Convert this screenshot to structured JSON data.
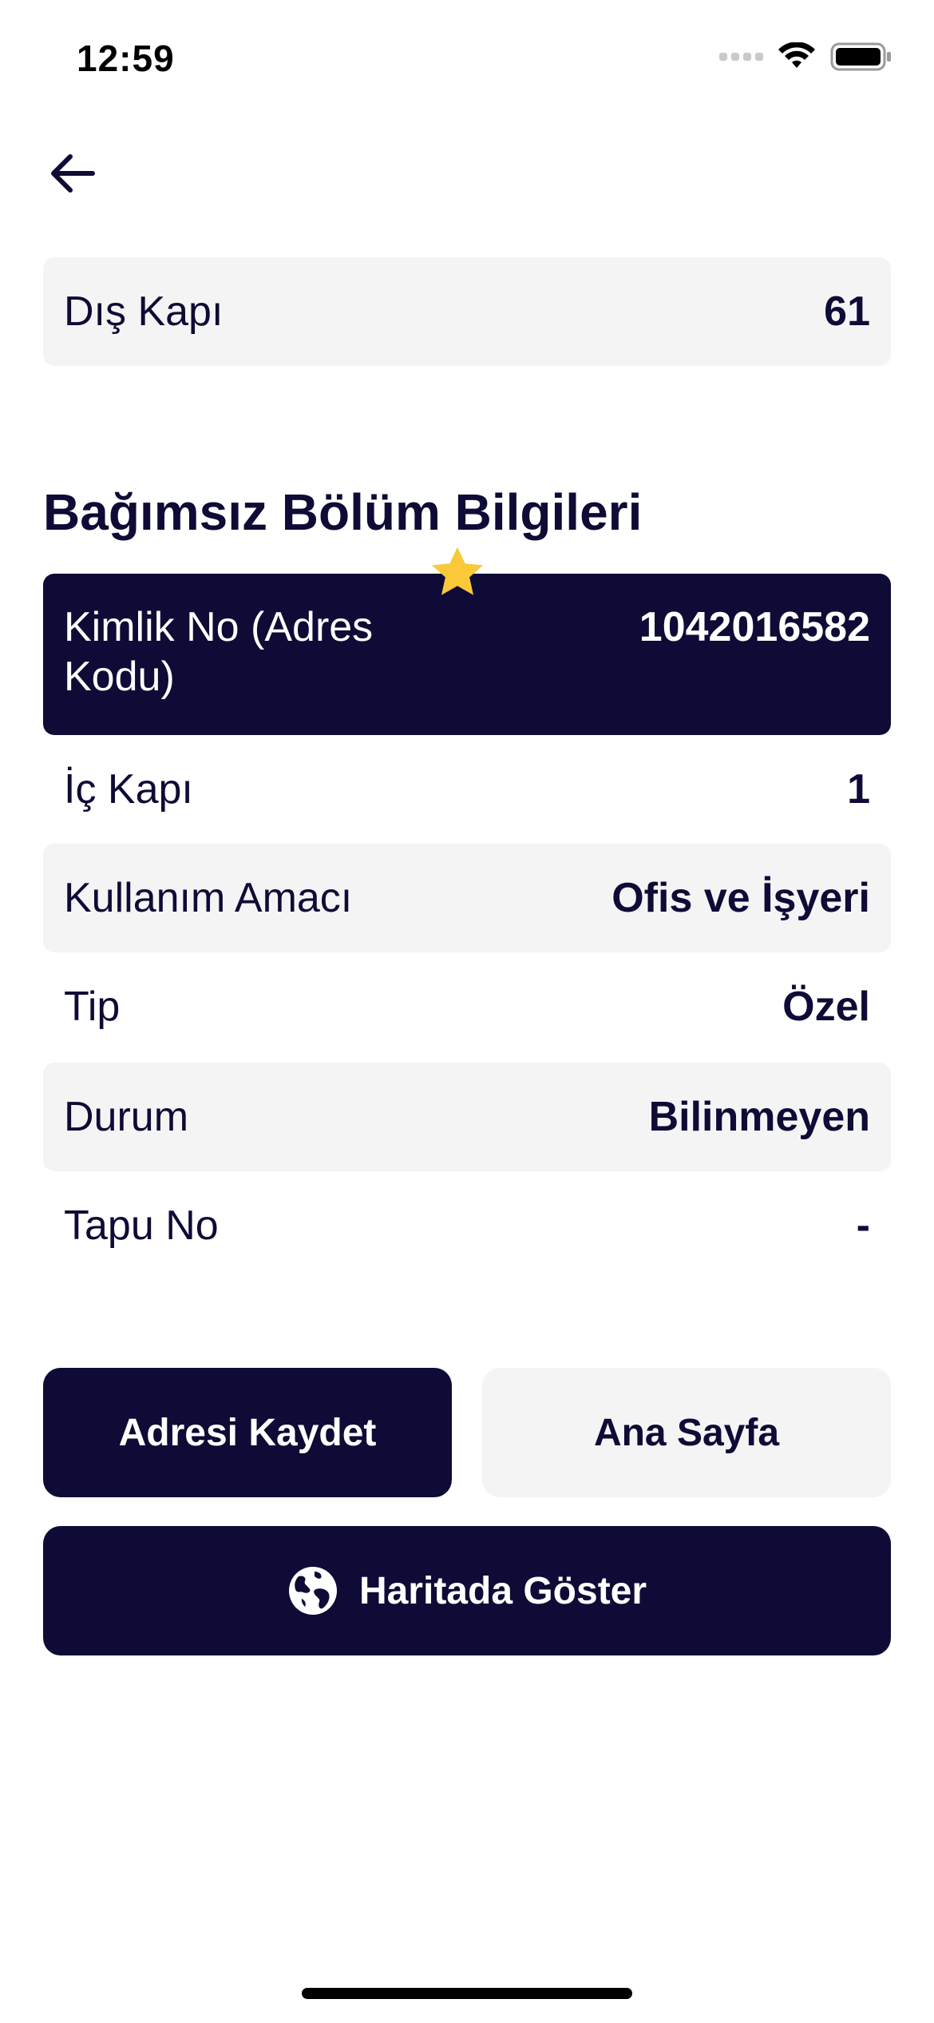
{
  "status_bar": {
    "time": "12:59"
  },
  "header": {
    "back_icon": "arrow-left-icon"
  },
  "address_row": {
    "label": "Dış Kapı",
    "value": "61"
  },
  "section": {
    "title": "Bağımsız Bölüm Bilgileri",
    "favorite_icon": "star-icon",
    "favorite_color": "#f9c93a"
  },
  "details": {
    "id_row": {
      "label": "Kimlik No (Adres Kodu)",
      "value": "1042016582"
    },
    "inner_door": {
      "label": "İç Kapı",
      "value": "1"
    },
    "usage": {
      "label": "Kullanım Amacı",
      "value": "Ofis ve İşyeri"
    },
    "type": {
      "label": "Tip",
      "value": "Özel"
    },
    "status": {
      "label": "Durum",
      "value": "Bilinmeyen"
    },
    "deed": {
      "label": "Tapu No",
      "value": "-"
    }
  },
  "actions": {
    "save_label": "Adresi Kaydet",
    "home_label": "Ana Sayfa",
    "map_label": "Haritada Göster",
    "map_icon": "globe-icon"
  },
  "colors": {
    "primary": "#0e0b36",
    "surface": "#f4f4f5",
    "accent_star": "#f9c93a"
  }
}
